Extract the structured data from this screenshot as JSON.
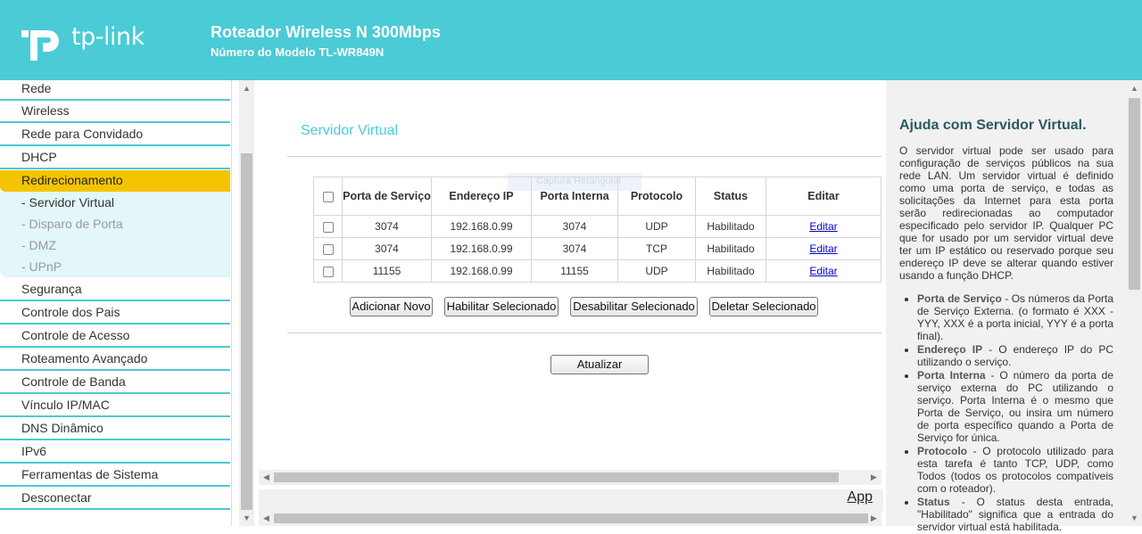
{
  "header": {
    "logo_text": "tp-link",
    "title": "Roteador Wireless N 300Mbps",
    "subtitle": "Número do Modelo TL-WR849N"
  },
  "sidebar": {
    "items_top": [
      "Rede",
      "Wireless",
      "Rede para Convidado",
      "DHCP",
      "Redirecionamento"
    ],
    "submenu": [
      "- Servidor Virtual",
      "- Disparo de Porta",
      "- DMZ",
      "- UPnP"
    ],
    "items_bottom": [
      "Segurança",
      "Controle dos Pais",
      "Controle de Acesso",
      "Roteamento Avançado",
      "Controle de Banda",
      "Vínculo IP/MAC",
      "DNS Dinâmico",
      "IPv6",
      "Ferramentas de Sistema",
      "Desconectar"
    ]
  },
  "main": {
    "page_title": "Servidor Virtual",
    "watermark": "Captura Retangular",
    "table": {
      "headers": [
        "Porta de Serviço",
        "Endereço IP",
        "Porta Interna",
        "Protocolo",
        "Status",
        "Editar"
      ],
      "rows": [
        {
          "port": "3074",
          "ip": "192.168.0.99",
          "internal": "3074",
          "protocol": "UDP",
          "status": "Habilitado",
          "edit": "Editar"
        },
        {
          "port": "3074",
          "ip": "192.168.0.99",
          "internal": "3074",
          "protocol": "TCP",
          "status": "Habilitado",
          "edit": "Editar"
        },
        {
          "port": "11155",
          "ip": "192.168.0.99",
          "internal": "11155",
          "protocol": "UDP",
          "status": "Habilitado",
          "edit": "Editar"
        }
      ]
    },
    "buttons": {
      "add": "Adicionar Novo",
      "enable": "Habilitar Selecionado",
      "disable": "Desabilitar Selecionado",
      "delete": "Deletar Selecionado",
      "refresh": "Atualizar"
    },
    "app_link": "App"
  },
  "help": {
    "title": "Ajuda com Servidor Virtual.",
    "intro": "O servidor virtual pode ser usado para configuração de serviços públicos na sua rede LAN. Um servidor virtual é definido como uma porta de serviço, e todas as solicitações da Internet para esta porta serão redirecionadas ao computador especificado pelo servidor IP. Qualquer PC que for usado por um servidor virtual deve ter um IP estático ou reservado porque seu endereço IP deve se alterar quando estiver usando a função DHCP.",
    "items": [
      {
        "term": "Porta de Serviço",
        "text": " - Os números da Porta de Serviço Externa. (o formato é XXX - YYY, XXX é a porta inicial, YYY é a porta final)."
      },
      {
        "term": "Endereço IP",
        "text": " - O endereço IP do PC utilizando o serviço."
      },
      {
        "term": "Porta Interna",
        "text": " - O número da porta de serviço externa do PC utilizando o serviço. Porta Interna é o mesmo que Porta de Serviço, ou insira um número de porta específico quando a Porta de Serviço for única."
      },
      {
        "term": "Protocolo",
        "text": " - O protocolo utilizado para esta tarefa é tanto TCP, UDP, como Todos (todos os protocolos compatíveis com o roteador)."
      },
      {
        "term": "Status",
        "text": " - O status desta entrada, \"Habilitado\" significa que a entrada do servidor virtual está habilitada."
      }
    ]
  }
}
